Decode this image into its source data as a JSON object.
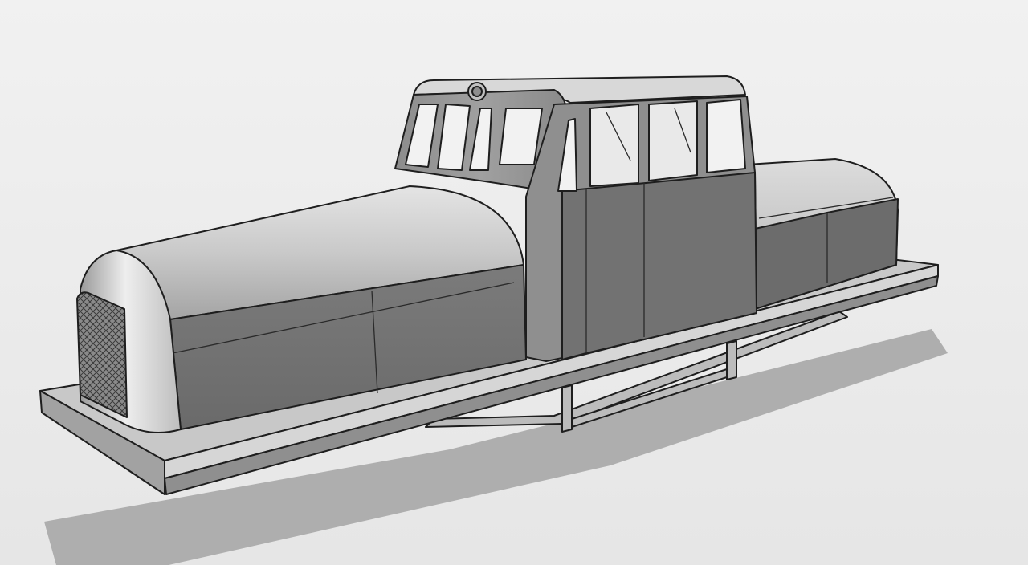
{
  "viewport": {
    "background_top": "#f1f1f1",
    "background_bottom": "#e6e6e6"
  },
  "model": {
    "shade_light": "#d4d4d4",
    "shade_mid": "#a9a9a9",
    "shade_dark": "#6f6f6f",
    "shade_darkest": "#555555",
    "edge_color": "#1e1e1e",
    "shadow_color": "#9a9a9a"
  }
}
